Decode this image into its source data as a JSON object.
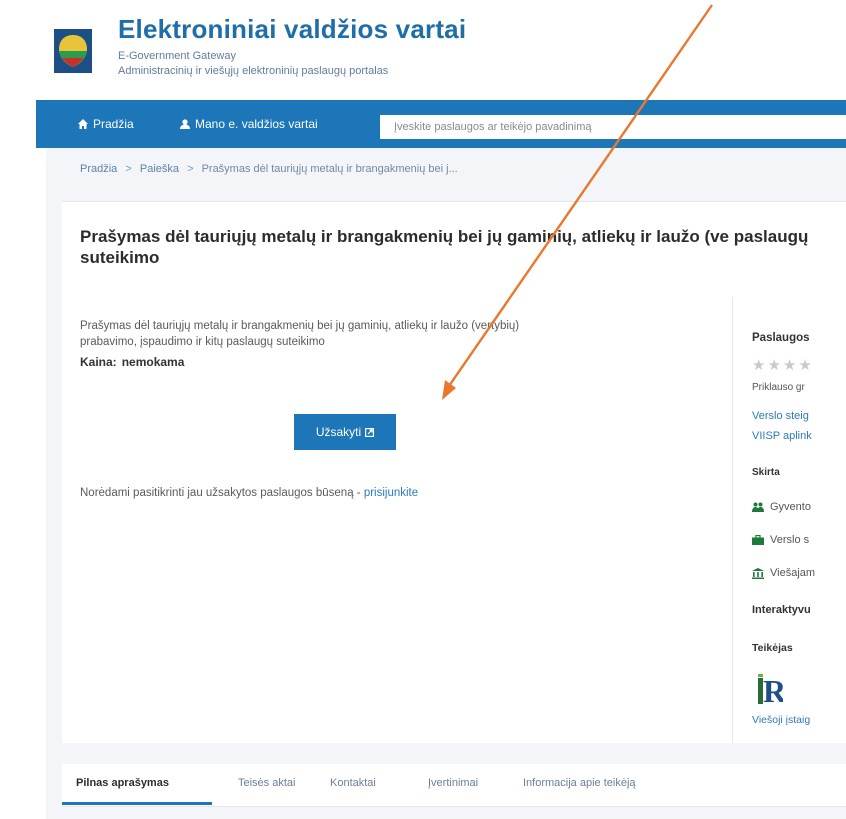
{
  "header": {
    "title": "Elektroniniai valdžios vartai",
    "subtitle_en": "E-Government Gateway",
    "subtitle_lt": "Administracinių ir viešųjų elektroninių paslaugų portalas"
  },
  "nav": {
    "home_label": "Pradžia",
    "my_label": "Mano e. valdžios vartai",
    "search_placeholder": "Įveskite paslaugos ar teikėjo pavadinimą"
  },
  "breadcrumb": {
    "items": [
      "Pradžia",
      "Paieška",
      "Prašymas dėl tauriųjų metalų ir brangakmenių bei j..."
    ],
    "separator": ">"
  },
  "service": {
    "title": "Prašymas dėl tauriųjų metalų ir brangakmenių bei jų gaminių, atliekų ir laužo (ve paslaugų suteikimo",
    "description": "Prašymas dėl tauriųjų metalų ir brangakmenių bei jų gaminių, atliekų ir laužo (vertybių) prabavimo, įspaudimo ir kitų paslaugų suteikimo",
    "price_label": "Kaina:",
    "price_value": "nemokama",
    "order_button": "Užsakyti",
    "status_text": "Norėdami pasitikrinti jau užsakytos paslaugos būseną - ",
    "status_link": "prisijunkite"
  },
  "sidebar": {
    "heading": "Paslaugos",
    "stars": "★★★★",
    "group_label": "Priklauso gr",
    "link1": "Verslo steig",
    "link2": "VIISP aplink",
    "audience_heading": "Skirta",
    "audience": [
      "Gyvento",
      "Verslo s",
      "Viešajam"
    ],
    "interactive_label": "Interaktyvu",
    "provider_heading": "Teikėjas",
    "provider_logo_text": "R",
    "provider_type": "Viešoji įstaig"
  },
  "tabs": [
    "Pilnas aprašymas",
    "Teisės aktai",
    "Kontaktai",
    "Įvertinimai",
    "Informacija apie teikėją"
  ],
  "colors": {
    "brand_blue": "#1d76b8",
    "link_blue": "#2b7bbd",
    "annotation_arrow": "#e8782e",
    "audience_icon_green": "#1e7a3a"
  }
}
